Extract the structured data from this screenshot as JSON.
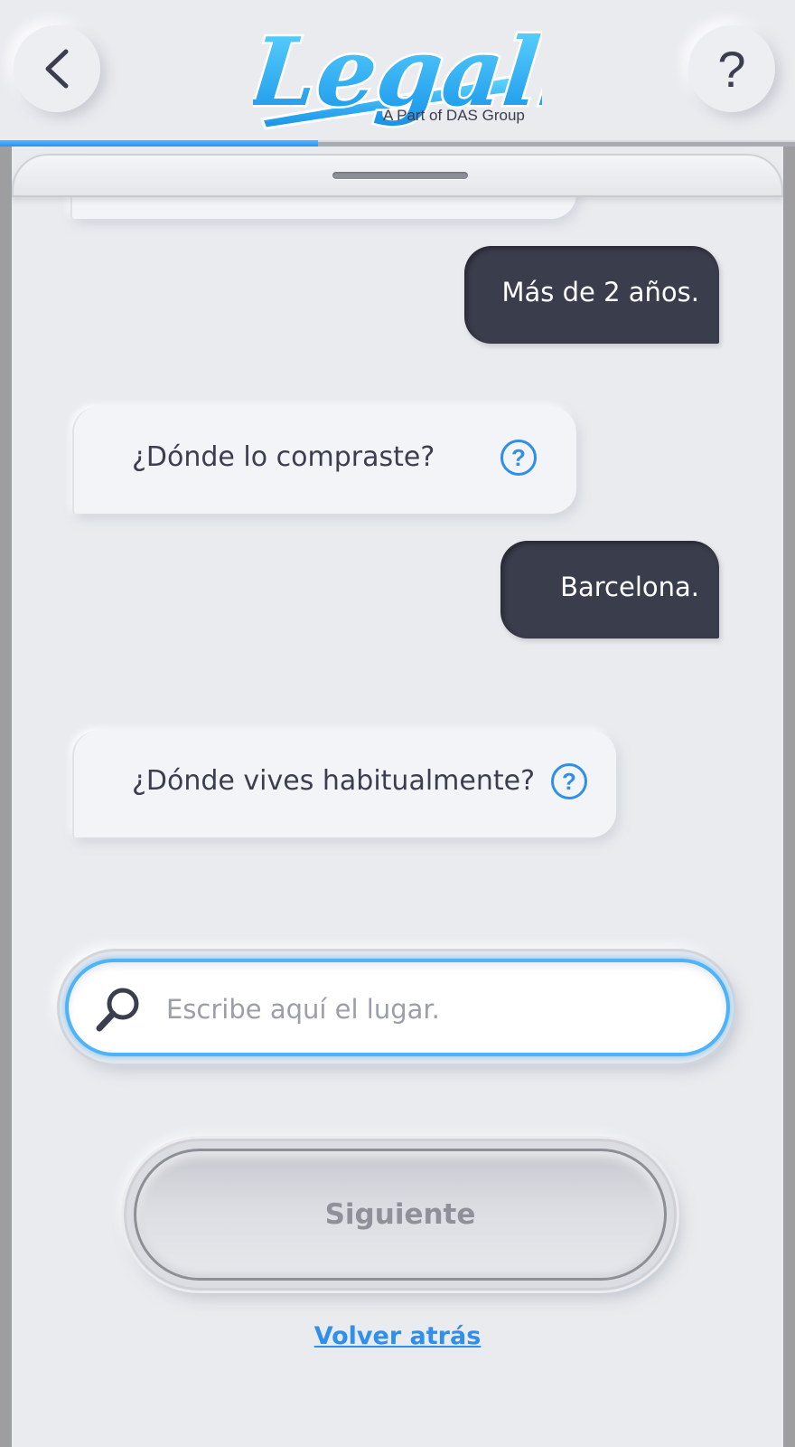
{
  "header": {
    "back_icon": "chevron-left-icon",
    "help_label": "?",
    "logo_text": "Legally",
    "logo_tagline": "A Part of DAS Group",
    "progress": 0.4,
    "accent_color": "#2f8fe9"
  },
  "chat": {
    "messages": [
      {
        "from": "user",
        "text": "Más de 2 años."
      },
      {
        "from": "bot",
        "text": "¿Dónde lo compraste?",
        "help_icon": "?"
      },
      {
        "from": "user",
        "text": "Barcelona."
      },
      {
        "from": "bot",
        "text": "¿Dónde vives habitualmente?",
        "help_icon": "?"
      }
    ]
  },
  "search": {
    "placeholder": "Escribe aquí el lugar.",
    "value": "",
    "icon": "search-icon"
  },
  "actions": {
    "next_label": "Siguiente",
    "back_link_label": "Volver atrás"
  }
}
